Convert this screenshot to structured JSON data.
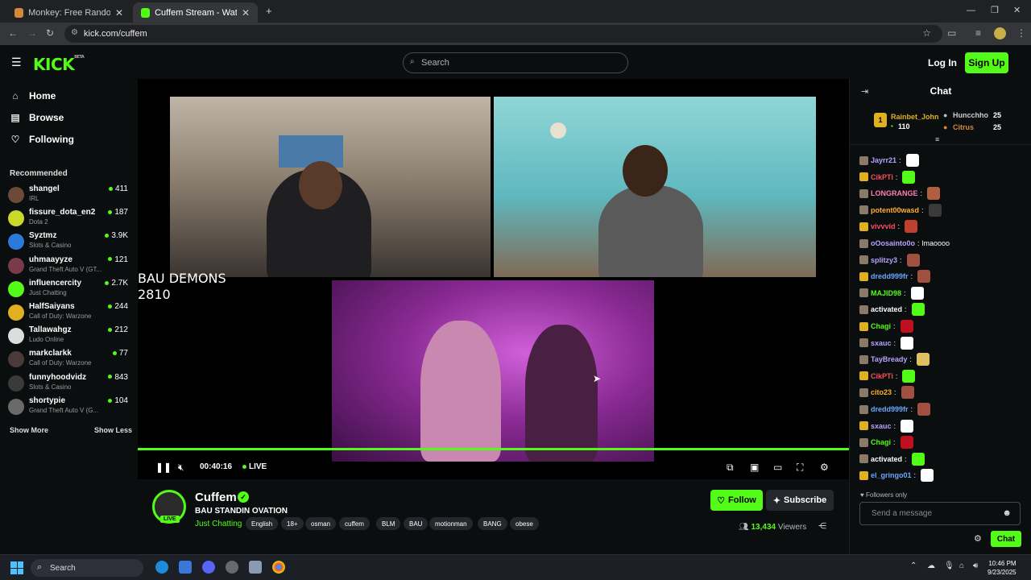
{
  "browser": {
    "tabs": [
      {
        "title": "Monkey: Free Random Video C",
        "favicon": "monkey-icon"
      },
      {
        "title": "Cuffem Stream - Watch Live or",
        "favicon": "kick-icon"
      }
    ],
    "url": "kick.com/cuffem",
    "window_controls": [
      "minimize-icon",
      "restore-icon",
      "close-icon"
    ]
  },
  "header": {
    "logo": "KICK",
    "logo_sup": "BETA",
    "search_placeholder": "Search",
    "login_label": "Log In",
    "signup_label": "Sign Up"
  },
  "sidebar": {
    "nav": [
      {
        "label": "Home",
        "icon": "home-icon"
      },
      {
        "label": "Browse",
        "icon": "browse-icon"
      },
      {
        "label": "Following",
        "icon": "heart-icon"
      }
    ],
    "recommended_title": "Recommended",
    "recommended": [
      {
        "name": "shangel",
        "category": "IRL",
        "viewers": "411",
        "color": "#6b4a3a"
      },
      {
        "name": "fissure_dota_en2",
        "category": "Dota 2",
        "viewers": "187",
        "color": "#c9d92a"
      },
      {
        "name": "Syztmz",
        "category": "Slots & Casino",
        "viewers": "3.9K",
        "color": "#2a7ad9"
      },
      {
        "name": "uhmaayyze",
        "category": "Grand Theft Auto V (GT...",
        "viewers": "121",
        "color": "#7a3a4a"
      },
      {
        "name": "influencercity",
        "category": "Just Chatting",
        "viewers": "2.7K",
        "color": "#53fc18"
      },
      {
        "name": "HalfSaiyans",
        "category": "Call of Duty: Warzone",
        "viewers": "244",
        "color": "#e0b020"
      },
      {
        "name": "Tallawahgz",
        "category": "Ludo Online",
        "viewers": "212",
        "color": "#dddddd"
      },
      {
        "name": "markclarkk",
        "category": "Call of Duty: Warzone",
        "viewers": "77",
        "color": "#4a3a3a"
      },
      {
        "name": "funnyhoodvidz",
        "category": "Slots & Casino",
        "viewers": "843",
        "color": "#3a3a3a"
      },
      {
        "name": "shortypie",
        "category": "Grand Theft Auto V (G...",
        "viewers": "104",
        "color": "#6a6a6a"
      }
    ],
    "show_more": "Show More",
    "show_less": "Show Less"
  },
  "video": {
    "overlay_line1": "BAU DEMONS",
    "overlay_line2": "2810",
    "time": "00:40:16",
    "live_label": "LIVE",
    "progress": 1.0
  },
  "stream": {
    "channel_name": "Cuffem",
    "live_badge": "LIVE",
    "title": "BAU STANDIN OVATION",
    "category": "Just Chatting",
    "tags": [
      "English",
      "18+",
      "osman",
      "cuffem",
      "BLM",
      "BAU",
      "motionman",
      "BANG",
      "obese"
    ],
    "follow_label": "Follow",
    "subscribe_label": "Subscribe",
    "viewers": "13,434",
    "viewers_label": "Viewers"
  },
  "chat": {
    "title": "Chat",
    "leaderboard": [
      {
        "rank": "1",
        "name": "Rainbet_John",
        "value": "110"
      },
      {
        "name": "Huncchho",
        "value": "25"
      },
      {
        "name": "Citrus",
        "value": "25"
      }
    ],
    "messages": [
      {
        "user": "Jayrr21",
        "color": "#b8a2ff",
        "text": ""
      },
      {
        "user": "CikPTi",
        "color": "#ff4b5c",
        "text": ""
      },
      {
        "user": "LONGRANGE",
        "color": "#ff7fb0",
        "text": ""
      },
      {
        "user": "potent00wasd",
        "color": "#ffb02e",
        "text": ""
      },
      {
        "user": "vivvvid",
        "color": "#ff4b5c",
        "text": ""
      },
      {
        "user": "oOosainto0o",
        "color": "#b8a2ff",
        "text": "lmaoooo"
      },
      {
        "user": "splitzy3",
        "color": "#b8a2ff",
        "text": ""
      },
      {
        "user": "dredd999fr",
        "color": "#6aa8ff",
        "text": ""
      },
      {
        "user": "MAJID98",
        "color": "#53fc18",
        "text": ""
      },
      {
        "user": "activated",
        "color": "#ffffff",
        "text": ""
      },
      {
        "user": "Chagi",
        "color": "#53fc18",
        "text": ""
      },
      {
        "user": "sxauc",
        "color": "#b8a2ff",
        "text": ""
      },
      {
        "user": "TayBready",
        "color": "#b8a2ff",
        "text": ""
      },
      {
        "user": "CikPTi",
        "color": "#ff4b5c",
        "text": ""
      },
      {
        "user": "cito23",
        "color": "#ffb02e",
        "text": ""
      },
      {
        "user": "dredd999fr",
        "color": "#6aa8ff",
        "text": ""
      },
      {
        "user": "sxauc",
        "color": "#b8a2ff",
        "text": ""
      },
      {
        "user": "Chagi",
        "color": "#53fc18",
        "text": ""
      },
      {
        "user": "activated",
        "color": "#ffffff",
        "text": ""
      },
      {
        "user": "el_gringo01",
        "color": "#6aa8ff",
        "text": ""
      }
    ],
    "followers_only": "Followers only",
    "input_placeholder": "Send a message",
    "send_label": "Chat"
  },
  "taskbar": {
    "search_label": "Search",
    "time": "10:46 PM",
    "date": "9/23/2025"
  },
  "colors": {
    "accent": "#53fc18",
    "background": "#0b0e0f"
  }
}
